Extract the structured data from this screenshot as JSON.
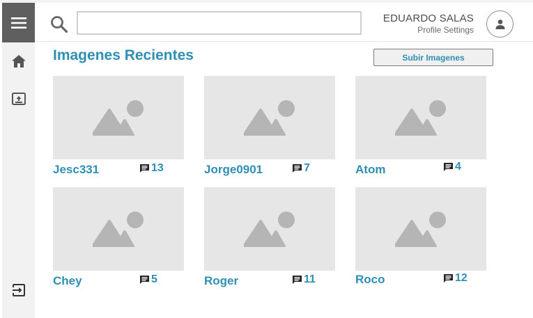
{
  "header": {
    "search_placeholder": "",
    "user_name": "EDUARDO SALAS",
    "profile_link": "Profile Settings"
  },
  "main": {
    "title": "Imagenes Recientes",
    "upload_label": "Subir Imagenes",
    "images": [
      {
        "author": "Jesc331",
        "comments": "13"
      },
      {
        "author": "Jorge0901",
        "comments": "7"
      },
      {
        "author": "Atom",
        "comments": "4"
      },
      {
        "author": "Chey",
        "comments": "5"
      },
      {
        "author": "Roger",
        "comments": "11"
      },
      {
        "author": "Roco",
        "comments": "12"
      }
    ]
  },
  "colors": {
    "accent": "#2f8fb3",
    "sidebar_bg": "#f2f2f2",
    "menu_bg": "#5f5f5f",
    "placeholder_bg": "#e6e6e6",
    "placeholder_glyph": "#b5b5b5"
  },
  "icons": {
    "menu": "menu-icon",
    "home": "home-icon",
    "images": "image-upload-icon",
    "logout": "logout-icon",
    "search": "search-icon",
    "avatar": "user-icon",
    "comment": "comment-icon"
  }
}
